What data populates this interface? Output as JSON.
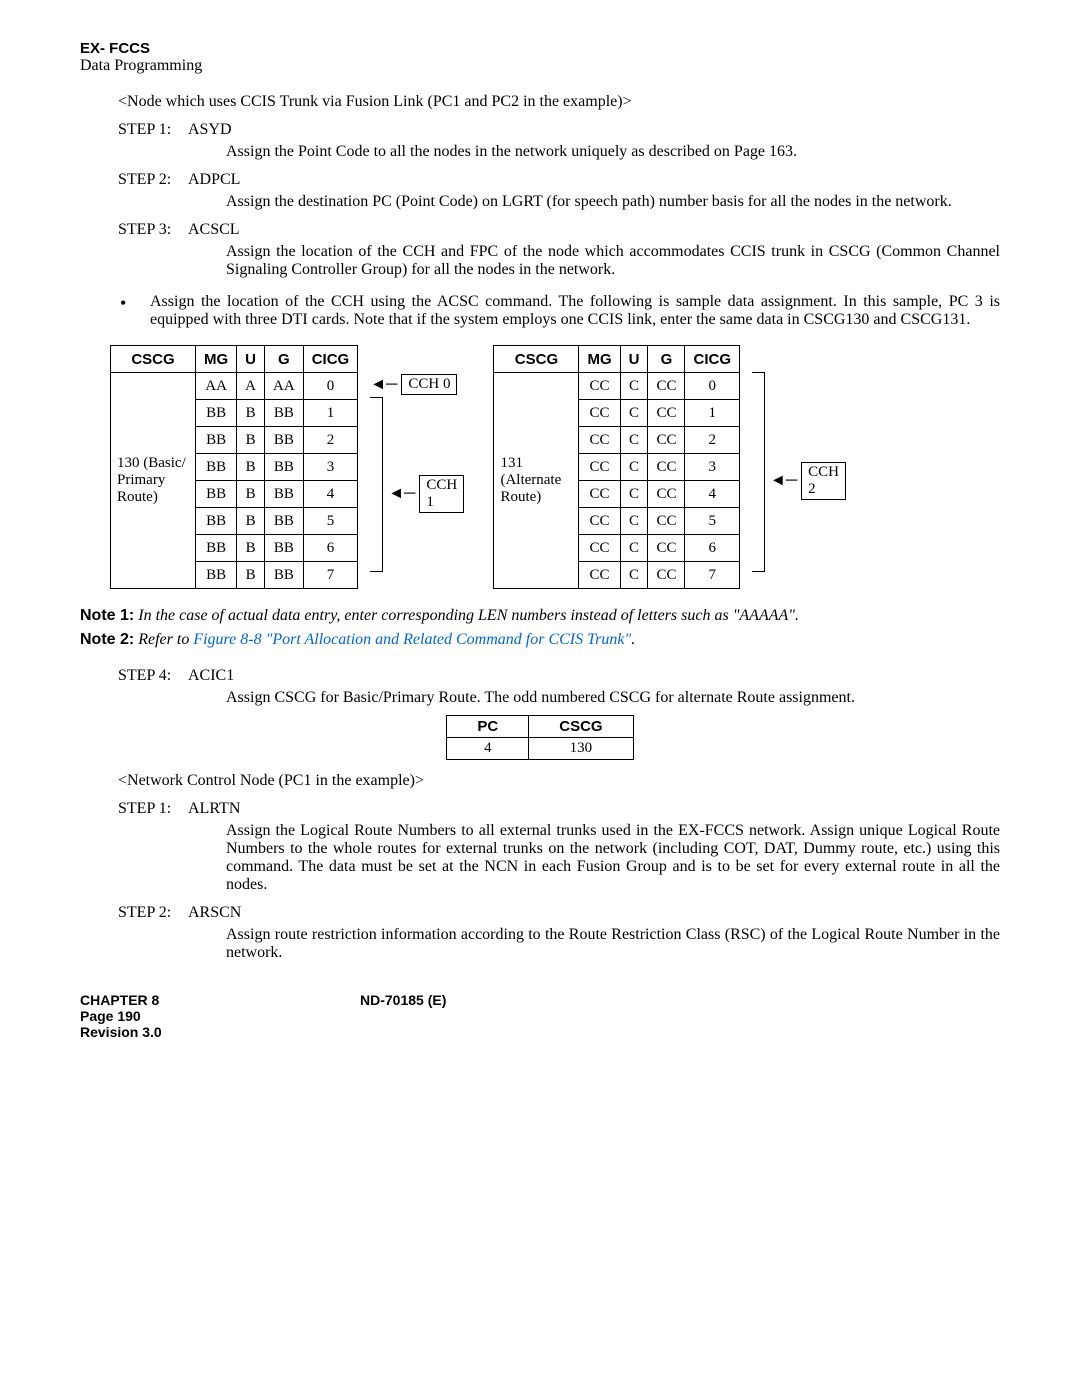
{
  "header": {
    "title": "EX- FCCS",
    "subtitle": "Data Programming"
  },
  "section1_label": "<Node which uses CCIS Trunk via Fusion Link (PC1 and PC2 in the example)>",
  "steps_a": [
    {
      "label": "STEP 1:",
      "cmd": "ASYD",
      "body": "Assign the Point Code to all the nodes in the network uniquely as described on Page 163."
    },
    {
      "label": "STEP 2:",
      "cmd": "ADPCL",
      "body": "Assign the destination PC (Point Code) on LGRT (for speech path) number basis for all the nodes in the network."
    },
    {
      "label": "STEP 3:",
      "cmd": "ACSCL",
      "body": "Assign the location of the CCH and FPC of the node which accommodates CCIS trunk in CSCG (Common Channel Signaling Controller Group) for all the nodes in the network."
    }
  ],
  "bullet_text": "Assign the location of the CCH using the ACSC command. The following is sample data assignment. In this sample, PC 3 is equipped with three DTI cards. Note that if the system employs one CCIS link, enter the same data in CSCG130 and CSCG131.",
  "table_headers": [
    "CSCG",
    "MG",
    "U",
    "G",
    "CICG"
  ],
  "table_left": {
    "rowhead": "130 (Basic/ Primary Route)",
    "rows": [
      [
        "AA",
        "A",
        "AA",
        "0"
      ],
      [
        "BB",
        "B",
        "BB",
        "1"
      ],
      [
        "BB",
        "B",
        "BB",
        "2"
      ],
      [
        "BB",
        "B",
        "BB",
        "3"
      ],
      [
        "BB",
        "B",
        "BB",
        "4"
      ],
      [
        "BB",
        "B",
        "BB",
        "5"
      ],
      [
        "BB",
        "B",
        "BB",
        "6"
      ],
      [
        "BB",
        "B",
        "BB",
        "7"
      ]
    ]
  },
  "table_right": {
    "rowhead": "131 (Alternate Route)",
    "rows": [
      [
        "CC",
        "C",
        "CC",
        "0"
      ],
      [
        "CC",
        "C",
        "CC",
        "1"
      ],
      [
        "CC",
        "C",
        "CC",
        "2"
      ],
      [
        "CC",
        "C",
        "CC",
        "3"
      ],
      [
        "CC",
        "C",
        "CC",
        "4"
      ],
      [
        "CC",
        "C",
        "CC",
        "5"
      ],
      [
        "CC",
        "C",
        "CC",
        "6"
      ],
      [
        "CC",
        "C",
        "CC",
        "7"
      ]
    ]
  },
  "cch_labels": [
    "CCH 0",
    "CCH 1",
    "CCH 2"
  ],
  "notes": {
    "n1_label": "Note 1:",
    "n1_text": "In the case of actual data entry, enter corresponding LEN numbers instead of letters such as \"AAAAA\".",
    "n2_label": "Note 2:",
    "n2_prefix": "Refer to ",
    "n2_link": "Figure 8-8 \"Port Allocation and Related Command for CCIS Trunk\"",
    "n2_suffix": "."
  },
  "step4": {
    "label": "STEP 4:",
    "cmd": "ACIC1",
    "body": "Assign CSCG for Basic/Primary Route. The odd numbered CSCG for alternate Route assignment."
  },
  "small_table": {
    "headers": [
      "PC",
      "CSCG"
    ],
    "row": [
      "4",
      "130"
    ]
  },
  "section2_label": "<Network Control Node (PC1 in the example)>",
  "steps_b": [
    {
      "label": "STEP 1:",
      "cmd": "ALRTN",
      "body": "Assign the Logical Route Numbers to all external trunks used in the EX-FCCS network. Assign unique Logical Route Numbers to the whole routes for external trunks on the network (including COT, DAT, Dummy route, etc.) using this command. The data must be set at the NCN in each Fusion Group and is to be set for every external route in all the nodes."
    },
    {
      "label": "STEP 2:",
      "cmd": "ARSCN",
      "body": "Assign route restriction information according to the Route Restriction Class (RSC) of the Logical Route Number in the network."
    }
  ],
  "footer": {
    "chapter": "CHAPTER 8",
    "page": "Page 190",
    "revision": "Revision 3.0",
    "docid": "ND-70185 (E)"
  }
}
